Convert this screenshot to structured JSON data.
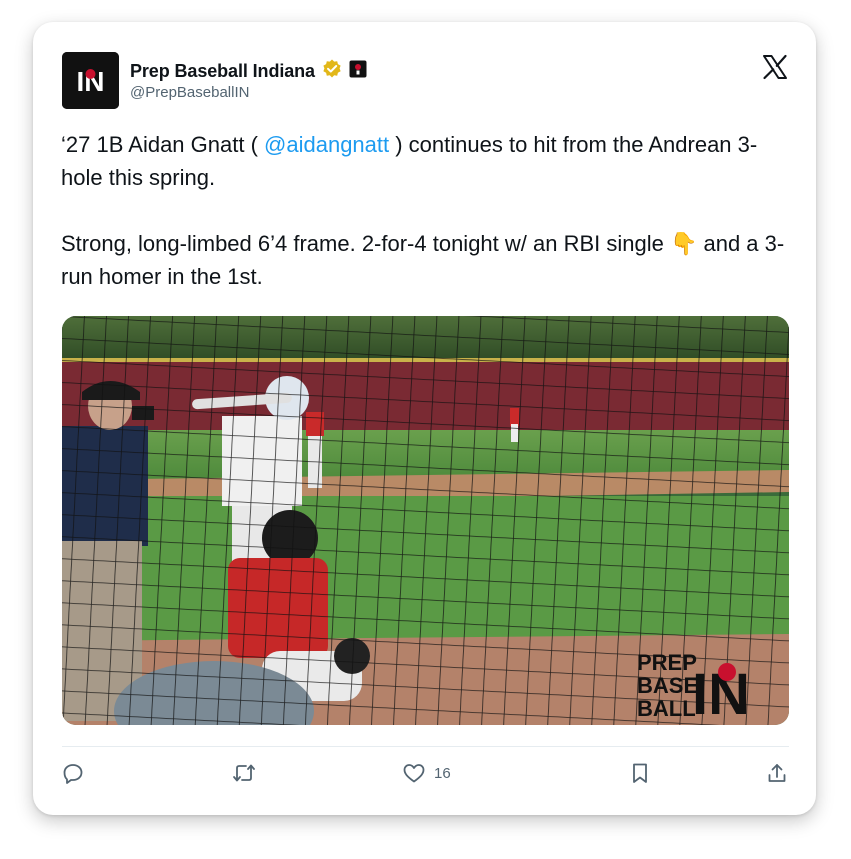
{
  "author": {
    "display_name": "Prep Baseball Indiana",
    "handle": "@PrepBaseballIN",
    "avatar_text": "IN",
    "verified_icon": "gold-checkmark-badge-icon",
    "affiliate_badge_icon": "affiliate-badge-icon"
  },
  "platform_logo": "x-logo-icon",
  "tweet": {
    "p1_before": "‘27 1B Aidan Gnatt ( ",
    "mention": "@aidangnatt",
    "p1_after": " ) continues to hit from the Andrean 3-hole this spring.",
    "p2": "Strong, long-limbed 6’4 frame. 2-for-4 tonight w/ an RBI single 👇 and a 3-run homer in the 1st."
  },
  "media": {
    "watermark_line1": "PREP",
    "watermark_line2": "BASE",
    "watermark_line3": "BALL",
    "watermark_mark": "IN"
  },
  "actions": {
    "reply_icon": "reply-icon",
    "retweet_icon": "retweet-icon",
    "like_icon": "heart-icon",
    "like_count": "16",
    "bookmark_icon": "bookmark-icon",
    "share_icon": "share-icon"
  },
  "colors": {
    "mention": "#1d9bf0",
    "text": "#0f1419",
    "secondary": "#536471",
    "verified": "#e2b719"
  }
}
